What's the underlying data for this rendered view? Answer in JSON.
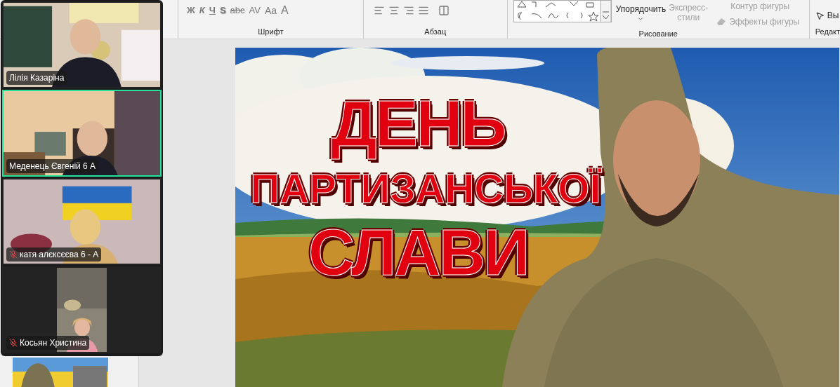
{
  "ribbon": {
    "font_group": {
      "label": "Шрифт",
      "buttons": [
        {
          "text": "Ж",
          "kind": "bold"
        },
        {
          "text": "К",
          "kind": "italic"
        },
        {
          "text": "Ч",
          "kind": "underline"
        },
        {
          "text": "S",
          "kind": "shadow"
        },
        {
          "text": "abc",
          "kind": "strike"
        },
        {
          "text": "AV",
          "kind": "spacing"
        },
        {
          "text": "Aa",
          "kind": "case"
        },
        {
          "text": "A",
          "kind": "color"
        }
      ]
    },
    "paragraph_group": {
      "label": "Абзац"
    },
    "drawing_group": {
      "label": "Рисование",
      "commands": [
        {
          "text": "Упорядочить",
          "disabled": false,
          "kind": "arrange"
        },
        {
          "text": "Экспресс-стили",
          "disabled": true,
          "kind": "styles"
        },
        {
          "text": "Контур фигуры",
          "disabled": true,
          "kind": "outline"
        },
        {
          "text": "Эффекты фигуры",
          "disabled": true,
          "kind": "effects"
        }
      ]
    },
    "editing_group": {
      "label": "Редакт",
      "select": "Вы"
    }
  },
  "participants": [
    {
      "name": "Лілія Казаріна",
      "speaking": false,
      "muted": false,
      "kind": "full"
    },
    {
      "name": "Меденець Євгеній 6 А",
      "speaking": true,
      "muted": false,
      "kind": "full"
    },
    {
      "name": "катя алєксєєва 6 - А",
      "speaking": false,
      "muted": true,
      "kind": "full"
    },
    {
      "name": "Косьян Христина",
      "speaking": false,
      "muted": true,
      "kind": "portrait"
    }
  ],
  "slide": {
    "title_lines": [
      "ДЕНЬ",
      "ПАРТИЗАНСЬКОЇ",
      "СЛАВИ"
    ]
  }
}
